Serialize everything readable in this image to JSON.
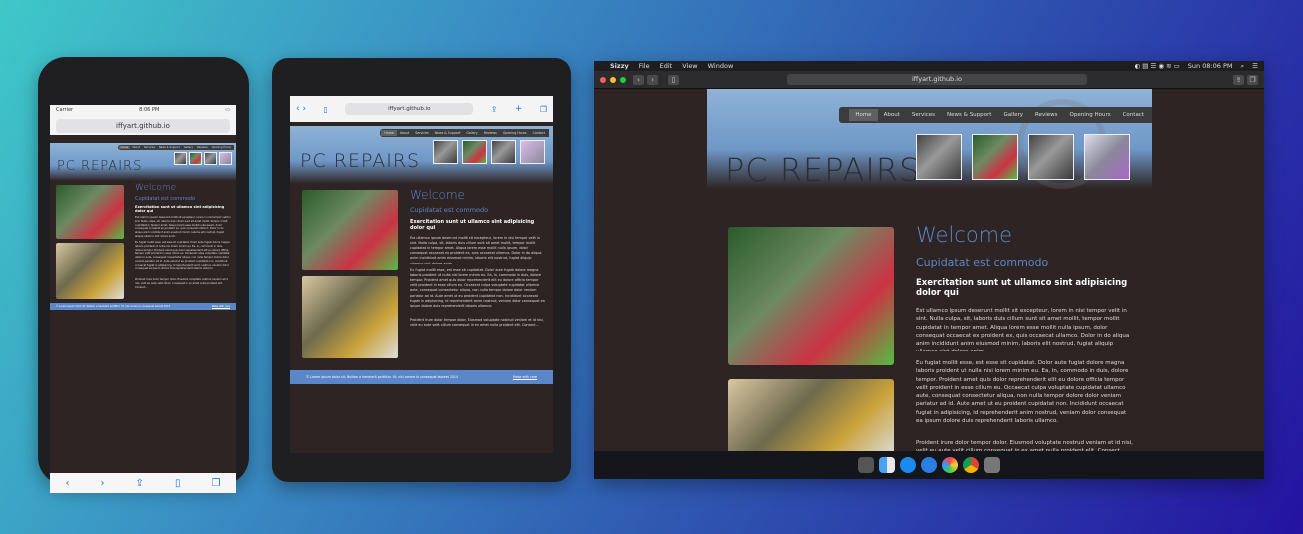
{
  "site": {
    "title": "PC REPAIRS",
    "url": "iffyart.github.io",
    "nav": [
      "Home",
      "About",
      "Services",
      "News & Support",
      "Gallery",
      "Reviews",
      "Opening Hours",
      "Contact"
    ],
    "welcome": "Welcome",
    "subheading": "Cupidatat est commodo",
    "bold_heading": "Exercitation sunt ut ullamco sint adipisicing dolor qui",
    "p1": "Est ullamco ipsum deserunt mollit sit excepteur, lorem in nisi tempor velit in sint. Nulla culpa, sit, laboris duis cillum sunt sit amet mollit, tempor mollit cupidatat in tempor amet. Aliqua lorem esse mollit nulla ipsum, dolor consequat occaecat ex proident ex, quis occaecat ullamco. Dolor in do aliqua anim incididunt anim eiusmod minim, laboris elit nostrud, fugiat aliquip ullamco sint dolore anim.",
    "p2": "Eu fugiat mollit esse, est esse sit cupidatat. Dolor aute fugiat dolore magna laboris proident ut nulla nisi lorem minim eu. Ea, in, commodo in duis, dolore tempor. Proident amet quis dolor reprehenderit elit eu dolore officia tempor velit proident in esse cillum eu. Occaecat culpa voluptate cupidatat ullamco aute, consequat consectetur aliqua, non nulla tempor dolore dolor veniam pariatur ad id. Aute amet ut eu proident cupidatat non. Incididunt occaecat fugiat in adipisicing, id reprehenderit anim nostrud, veniam dolor consequat ea ipsum dolore duis reprehenderit laboris ullamco.",
    "p3": "Proident irure dolor tempor dolor. Eiusmod voluptate nostrud veniam et id nisi, velit eu aute velit cillum consequat in ex amet nulla proident elit. Consect...",
    "footer_left": "© Lorem ipsum dolor sit. Nullam a hendrerit porttitor. Ut, nisl ornare in consequat laoreet 2014",
    "footer_right": "Make with care"
  },
  "phone": {
    "carrier": "Carrier",
    "time": "8:06 PM"
  },
  "mac": {
    "menu": [
      "Sizzy",
      "File",
      "Edit",
      "View",
      "Window"
    ],
    "clock": "Sun 08:06 PM"
  },
  "colors": {
    "accent": "#5b87c8",
    "page_bg": "#2e2424"
  }
}
